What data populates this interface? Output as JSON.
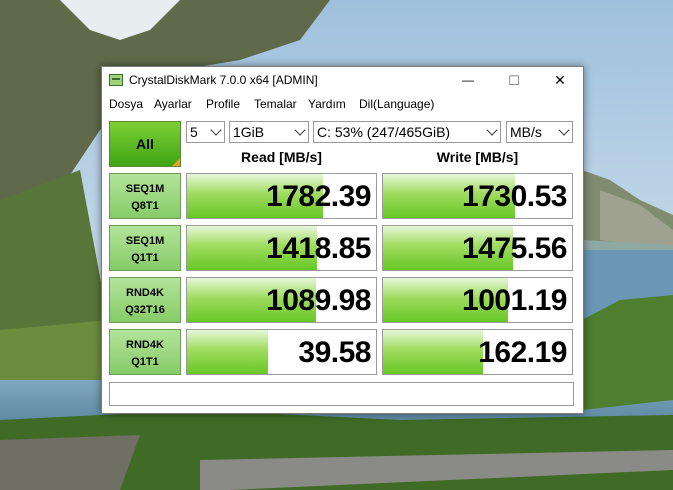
{
  "window": {
    "title": "CrystalDiskMark 7.0.0 x64 [ADMIN]",
    "minimize_glyph": "—",
    "maximize_glyph": "☐",
    "close_glyph": "✕"
  },
  "menu": [
    "Dosya",
    "Ayarlar",
    "Profile",
    "Temalar",
    "Yardım",
    "Dil(Language)"
  ],
  "controls": {
    "all_label": "All",
    "count": "5",
    "size": "1GiB",
    "drive": "C: 53% (247/465GiB)",
    "unit": "MB/s"
  },
  "headers": {
    "read": "Read [MB/s]",
    "write": "Write [MB/s]"
  },
  "tests": [
    {
      "line1": "SEQ1M",
      "line2": "Q8T1",
      "read": "1782.39",
      "write": "1730.53",
      "read_fill": 0.72,
      "write_fill": 0.7
    },
    {
      "line1": "SEQ1M",
      "line2": "Q1T1",
      "read": "1418.85",
      "write": "1475.56",
      "read_fill": 0.69,
      "write_fill": 0.69
    },
    {
      "line1": "RND4K",
      "line2": "Q32T16",
      "read": "1089.98",
      "write": "1001.19",
      "read_fill": 0.68,
      "write_fill": 0.66
    },
    {
      "line1": "RND4K",
      "line2": "Q1T1",
      "read": "39.58",
      "write": "162.19",
      "read_fill": 0.43,
      "write_fill": 0.53
    }
  ],
  "comment": "",
  "colors": {
    "accent_green": "#67c726",
    "button_green": "#3fa414"
  }
}
